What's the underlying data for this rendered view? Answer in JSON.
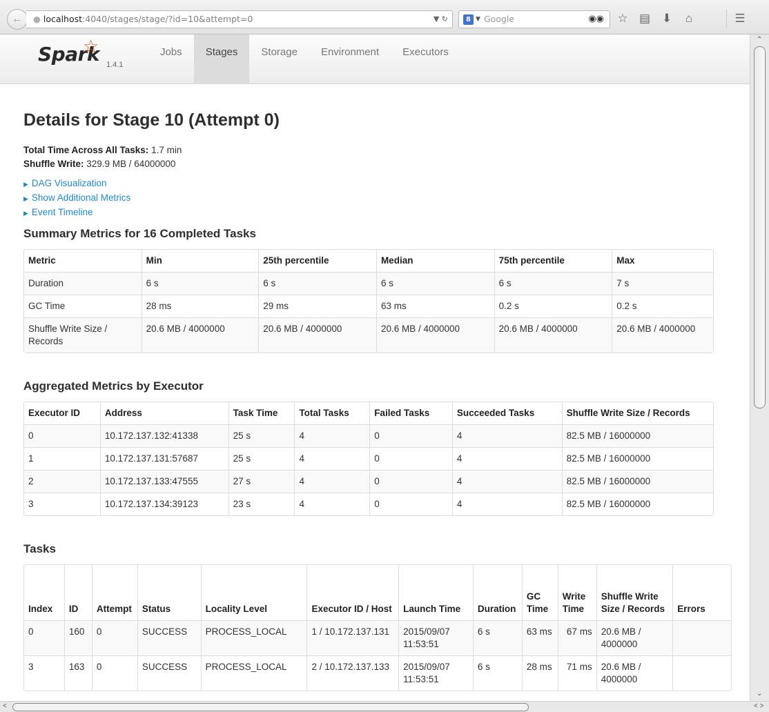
{
  "browser": {
    "url_host": "localhost",
    "url_path": ":4040/stages/stage/?id=10&attempt=0",
    "search_placeholder": "Google",
    "search_engine_badge": "8"
  },
  "nav": {
    "brand": "Spark",
    "version": "1.4.1",
    "tabs": [
      "Jobs",
      "Stages",
      "Storage",
      "Environment",
      "Executors"
    ],
    "active_tab": "Stages"
  },
  "page": {
    "title": "Details for Stage 10 (Attempt 0)",
    "total_time_label": "Total Time Across All Tasks:",
    "total_time_value": "1.7 min",
    "shuffle_write_label": "Shuffle Write:",
    "shuffle_write_value": "329.9 MB / 64000000",
    "links": [
      "DAG Visualization",
      "Show Additional Metrics",
      "Event Timeline"
    ]
  },
  "summary_metrics": {
    "heading": "Summary Metrics for 16 Completed Tasks",
    "columns": [
      "Metric",
      "Min",
      "25th percentile",
      "Median",
      "75th percentile",
      "Max"
    ],
    "rows": [
      [
        "Duration",
        "6 s",
        "6 s",
        "6 s",
        "6 s",
        "7 s"
      ],
      [
        "GC Time",
        "28 ms",
        "29 ms",
        "63 ms",
        "0.2 s",
        "0.2 s"
      ],
      [
        "Shuffle Write Size / Records",
        "20.6 MB / 4000000",
        "20.6 MB / 4000000",
        "20.6 MB / 4000000",
        "20.6 MB / 4000000",
        "20.6 MB / 4000000"
      ]
    ]
  },
  "executor_metrics": {
    "heading": "Aggregated Metrics by Executor",
    "columns": [
      "Executor ID",
      "Address",
      "Task Time",
      "Total Tasks",
      "Failed Tasks",
      "Succeeded Tasks",
      "Shuffle Write Size / Records"
    ],
    "rows": [
      [
        "0",
        "10.172.137.132:41338",
        "25 s",
        "4",
        "0",
        "4",
        "82.5 MB / 16000000"
      ],
      [
        "1",
        "10.172.137.131:57687",
        "25 s",
        "4",
        "0",
        "4",
        "82.5 MB / 16000000"
      ],
      [
        "2",
        "10.172.137.133:47555",
        "27 s",
        "4",
        "0",
        "4",
        "82.5 MB / 16000000"
      ],
      [
        "3",
        "10.172.137.134:39123",
        "23 s",
        "4",
        "0",
        "4",
        "82.5 MB / 16000000"
      ]
    ]
  },
  "tasks": {
    "heading": "Tasks",
    "columns": [
      "Index",
      "ID",
      "Attempt",
      "Status",
      "Locality Level",
      "Executor ID / Host",
      "Launch Time",
      "Duration",
      "GC Time",
      "Write Time",
      "Shuffle Write Size / Records",
      "Errors"
    ],
    "rows": [
      [
        "0",
        "160",
        "0",
        "SUCCESS",
        "PROCESS_LOCAL",
        "1 / 10.172.137.131",
        "2015/09/07 11:53:51",
        "6 s",
        "63 ms",
        "67 ms",
        "20.6 MB / 4000000",
        ""
      ],
      [
        "3",
        "163",
        "0",
        "SUCCESS",
        "PROCESS_LOCAL",
        "2 / 10.172.137.133",
        "2015/09/07 11:53:51",
        "6 s",
        "28 ms",
        "71 ms",
        "20.6 MB / 4000000",
        ""
      ]
    ]
  }
}
